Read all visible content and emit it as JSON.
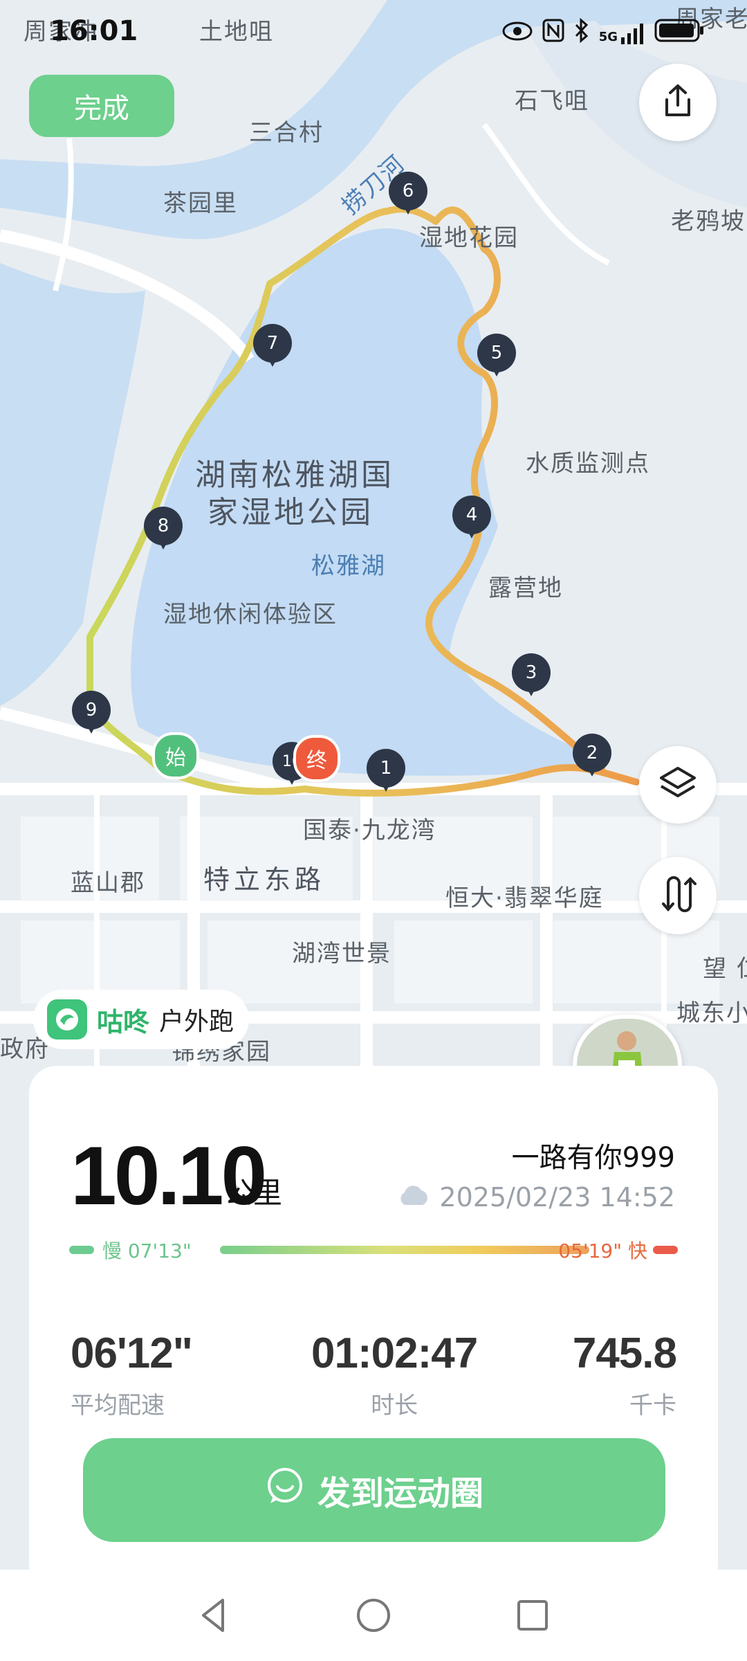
{
  "status_bar": {
    "time": "16:01",
    "network": "5G",
    "icons": [
      "eye-icon",
      "nfc-icon",
      "bluetooth-icon",
      "signal-icon",
      "battery-icon"
    ]
  },
  "header": {
    "done_label": "完成"
  },
  "map": {
    "place_labels": [
      "周家冲",
      "土地咀",
      "周家老",
      "石飞咀",
      "三合村",
      "捞刀河",
      "茶园里",
      "湿地花园",
      "老鸦坡",
      "湖南松雅湖国",
      "家湿地公园",
      "水质监测点",
      "松雅湖",
      "露营地",
      "湿地休闲体验区",
      "国泰·九龙湾",
      "蓝山郡",
      "特立东路",
      "恒大·翡翠华庭",
      "湖湾世景",
      "望 仁",
      "城东小",
      "政府",
      "锦绣家园"
    ],
    "km_markers": [
      "1",
      "2",
      "3",
      "4",
      "5",
      "6",
      "7",
      "8",
      "9",
      "10"
    ],
    "start_label": "始",
    "end_label": "终"
  },
  "activity": {
    "app_name": "咕咚",
    "type": "户外跑",
    "distance": "10.10",
    "distance_unit": "公里",
    "username": "一路有你999",
    "datetime": "2025/02/23 14:52",
    "pace_slow": "慢 07'13\"",
    "pace_fast": "05'19\" 快",
    "stats": [
      {
        "value": "06'12\"",
        "label": "平均配速"
      },
      {
        "value": "01:02:47",
        "label": "时长"
      },
      {
        "value": "745.8",
        "label": "千卡"
      }
    ]
  },
  "actions": {
    "post_label": "发到运动圈"
  },
  "colors": {
    "accent": "#6dd08d",
    "route_start": "#c9d85a",
    "route_end": "#ee9b4a"
  }
}
